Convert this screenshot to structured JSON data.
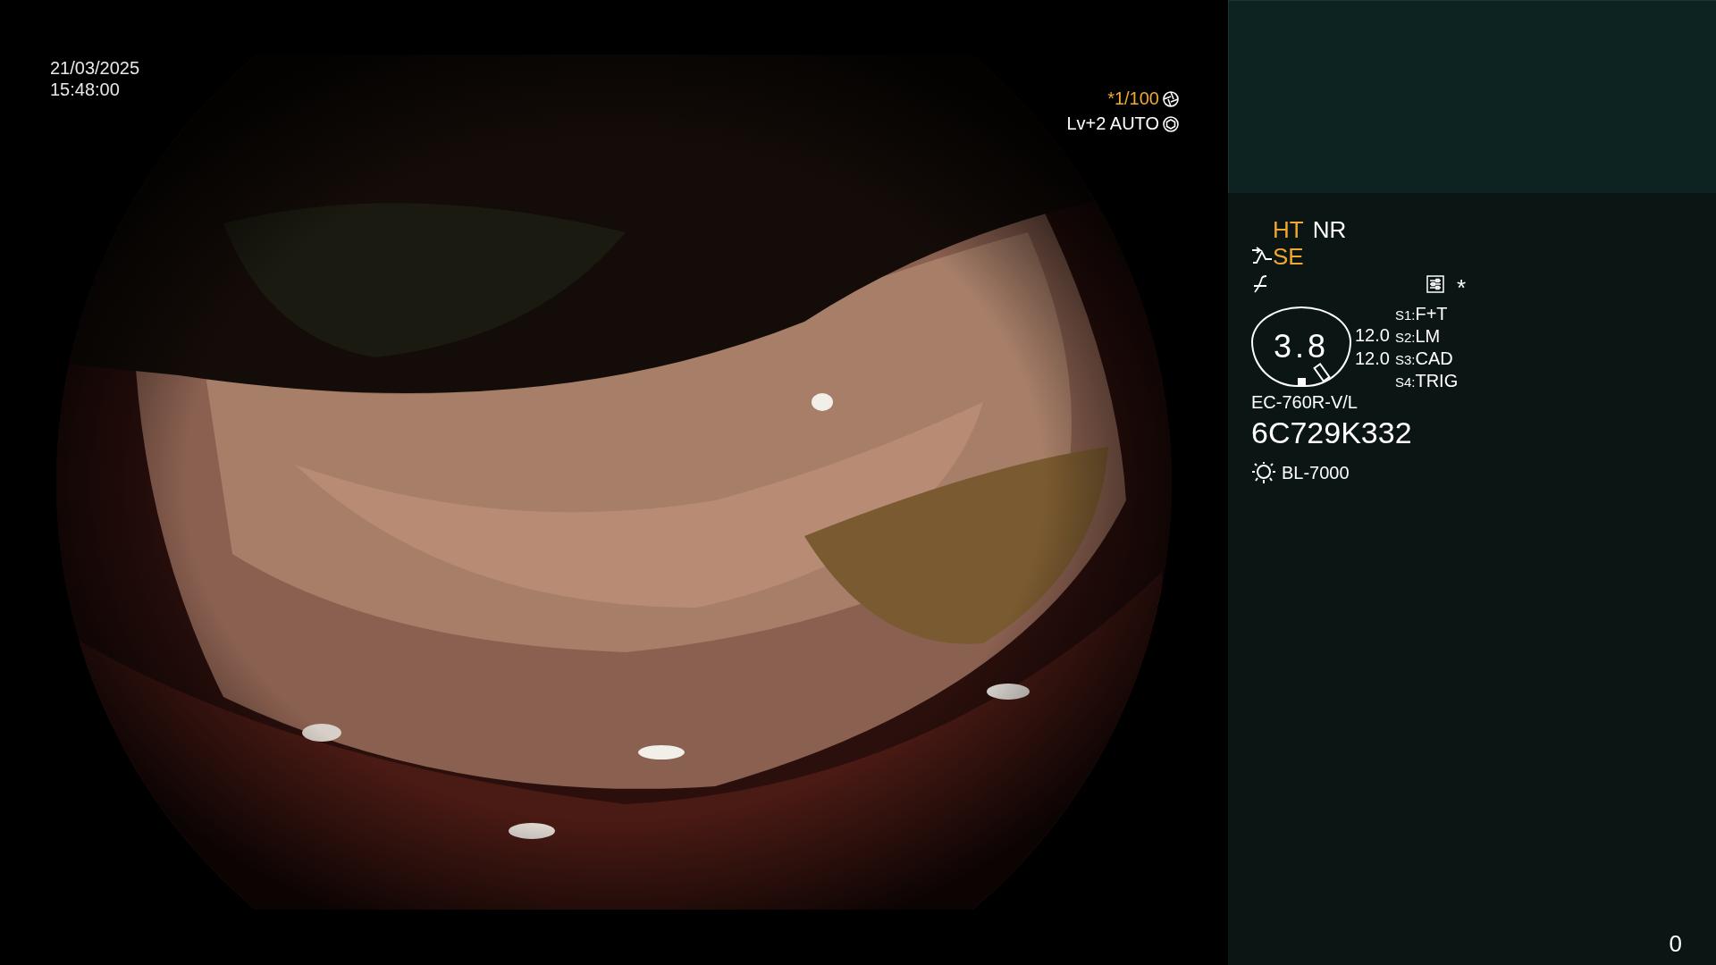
{
  "overlay": {
    "date": "21/03/2025",
    "time": "15:48:00",
    "shutter": "*1/100",
    "exposure": "Lv+2 AUTO"
  },
  "status": {
    "modes": [
      {
        "label": "HT",
        "color": "#f0a830"
      },
      {
        "label": "NR",
        "color": "#ffffff"
      }
    ],
    "enhancement": {
      "label": "SE",
      "color": "#f0a830"
    },
    "settings_mark": "*",
    "gauge": {
      "value": "3.8",
      "readings": [
        "12.0",
        "12.0"
      ]
    },
    "switches": [
      {
        "key": "S1:",
        "value": "F+T"
      },
      {
        "key": "S2:",
        "value": "LM"
      },
      {
        "key": "S3:",
        "value": "CAD"
      },
      {
        "key": "S4:",
        "value": "TRIG"
      }
    ],
    "scope_model": "EC-760R-V/L",
    "serial": "6C729K332",
    "light_source": "BL-7000"
  },
  "counter": "0"
}
